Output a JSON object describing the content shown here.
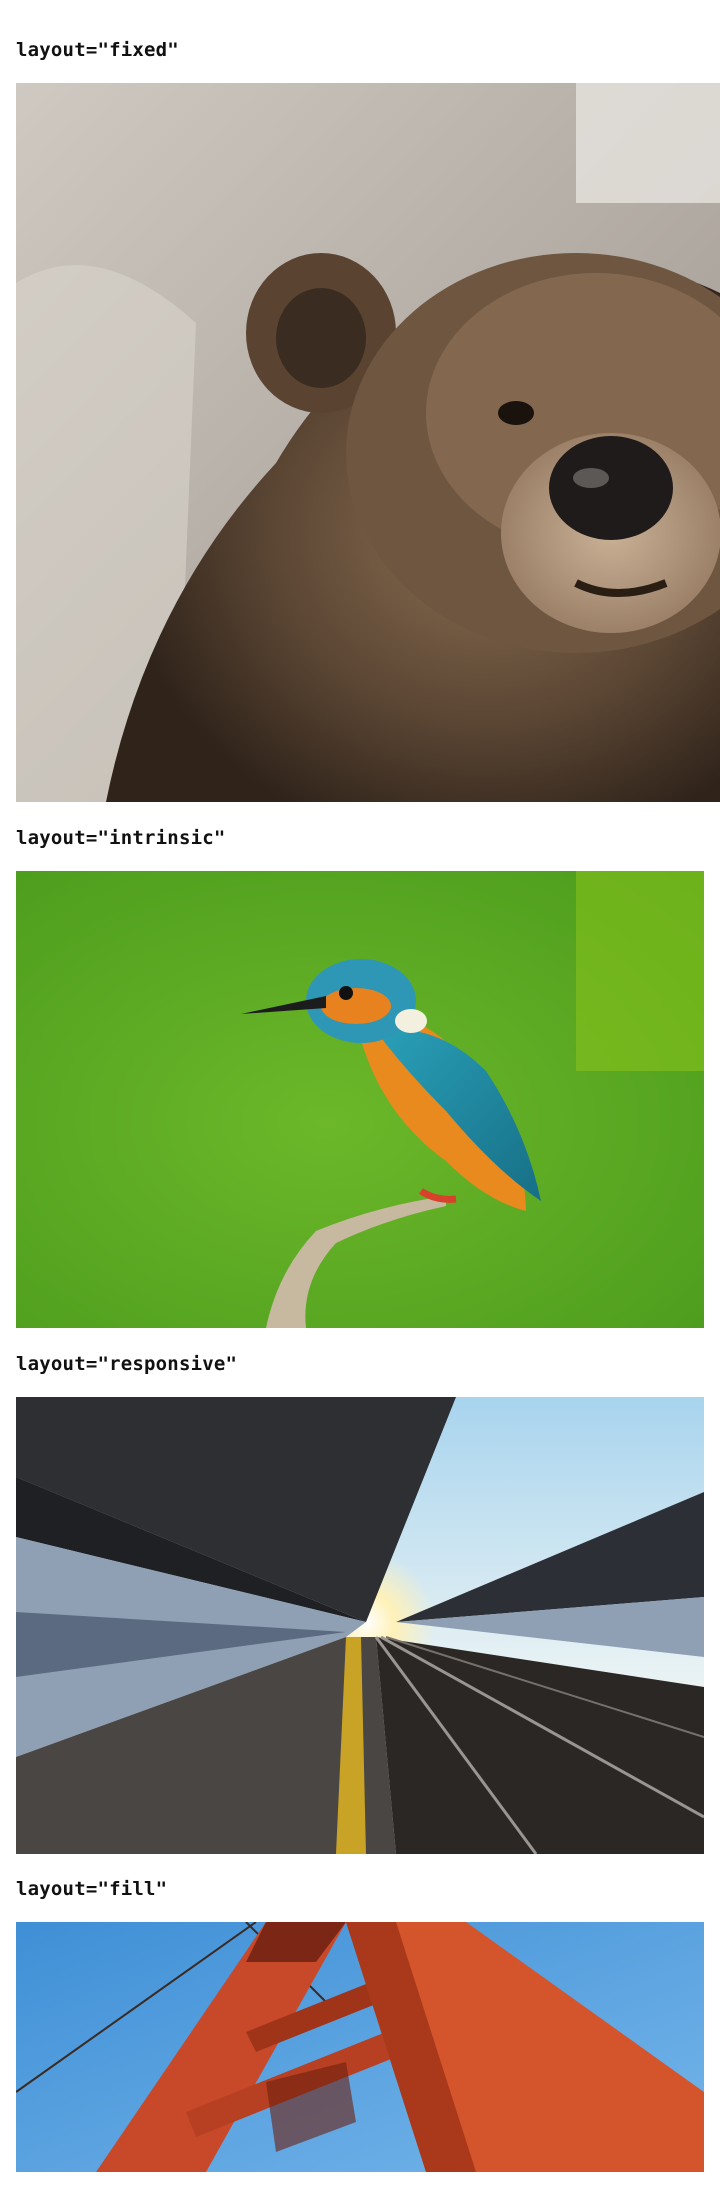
{
  "examples": [
    {
      "label": "layout=\"fixed\"",
      "image": "brown-bear-portrait"
    },
    {
      "label": "layout=\"intrinsic\"",
      "image": "kingfisher-on-branch"
    },
    {
      "label": "layout=\"responsive\"",
      "image": "empty-train-platform-sunset"
    },
    {
      "label": "layout=\"fill\"",
      "image": "golden-gate-bridge-tower"
    }
  ]
}
